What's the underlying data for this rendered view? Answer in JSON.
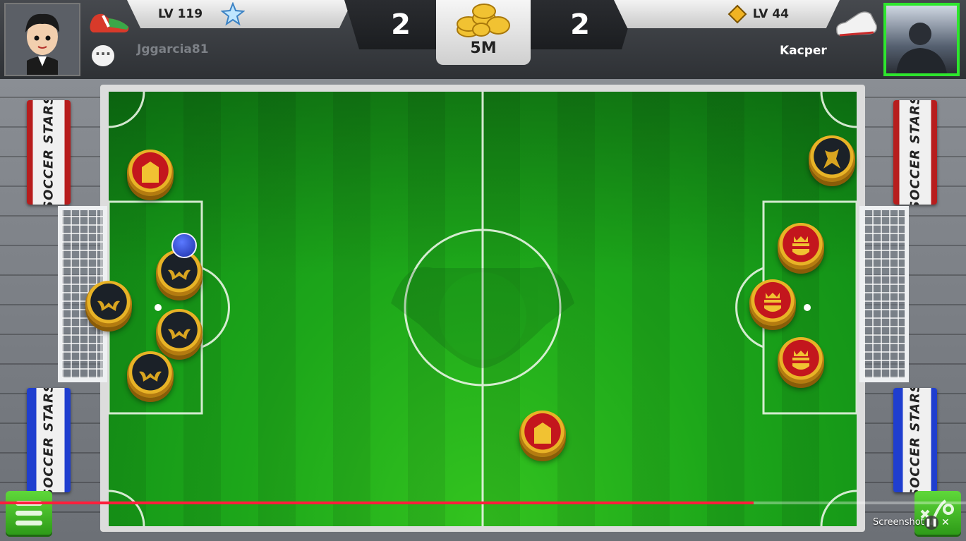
{
  "player_left": {
    "level": "LV 119",
    "name": "Jggarcia81",
    "score": "2"
  },
  "player_right": {
    "level": "LV 44",
    "name": "Kacper",
    "score": "2"
  },
  "pot": {
    "amount": "5M"
  },
  "banners": {
    "text": "SOCCER STARS"
  },
  "video_overlay": {
    "label": "Screenshot",
    "progress": 0.78
  },
  "colors": {
    "grass": "#1da71a",
    "active_player_border": "#2ee62e",
    "progress": "#ff1e3c",
    "menu_button": "#4cc22e"
  }
}
